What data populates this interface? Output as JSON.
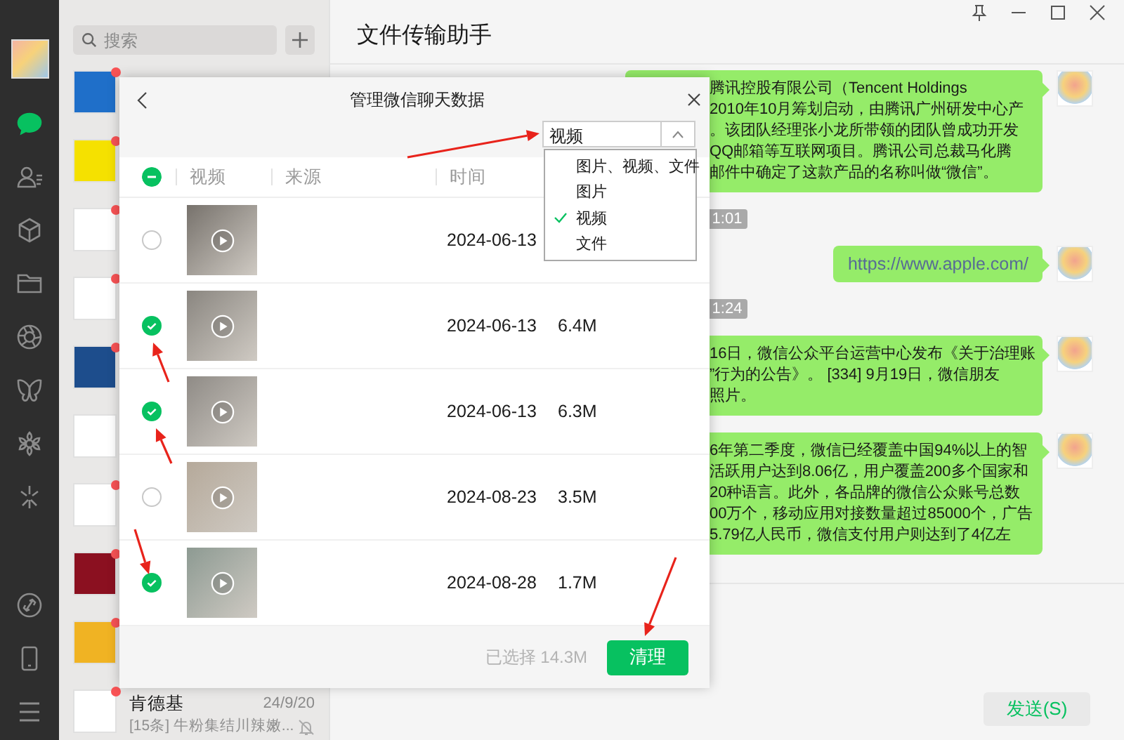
{
  "nav": {
    "top_items": [
      {
        "kind": "chat",
        "selected": true
      },
      {
        "kind": "contacts",
        "selected": false
      },
      {
        "kind": "cube",
        "selected": false
      },
      {
        "kind": "folder",
        "selected": false
      },
      {
        "kind": "aperture",
        "selected": false
      },
      {
        "kind": "butterfly",
        "selected": false
      },
      {
        "kind": "flower",
        "selected": false
      },
      {
        "kind": "sparkle",
        "selected": false
      }
    ],
    "bottom_items": [
      {
        "kind": "link"
      },
      {
        "kind": "phone"
      },
      {
        "kind": "menu"
      }
    ]
  },
  "search": {
    "placeholder": "搜索"
  },
  "chats": [
    {
      "unread": true
    },
    {
      "unread": true
    },
    {
      "unread": true
    },
    {
      "unread": true
    },
    {
      "unread": true
    },
    {
      "unread": false
    },
    {
      "unread": true
    },
    {
      "unread": true
    },
    {
      "unread": true
    },
    {
      "unread": true,
      "name": "肯德基",
      "time": "24/9/20",
      "preview": "[15条] 牛粉集结川辣嫩...",
      "muted": true
    }
  ],
  "chat": {
    "title": "文件传输助手",
    "messages": [
      {
        "kind": "text",
        "lines": [
          "腾讯控股有限公司（Tencent Holdings",
          "2010年10月筹划启动，由腾讯广州研发中心产",
          "。该团队经理张小龙所带领的团队曾成功开发",
          "QQ邮箱等互联网项目。腾讯公司总裁马化腾",
          "邮件中确定了这款产品的名称叫做“微信”。"
        ]
      },
      {
        "kind": "time",
        "text": "1:01"
      },
      {
        "kind": "link",
        "text": "https://www.apple.com/"
      },
      {
        "kind": "time",
        "text": "1:24"
      },
      {
        "kind": "text",
        "lines": [
          "16日，微信公众平台运营中心发布《关于治理账",
          "”行为的公告》。 [334] 9月19日，微信朋友",
          "照片。"
        ]
      },
      {
        "kind": "text",
        "lines": [
          "6年第二季度，微信已经覆盖中国94%以上的智",
          "活跃用户达到8.06亿，用户覆盖200多个国家和",
          "20种语言。此外，各品牌的微信公众账号总数",
          "00万个，移动应用对接数量超过85000个，广告",
          "5.79亿人民币，微信支付用户则达到了4亿左"
        ]
      }
    ],
    "send_button": "发送(S)"
  },
  "dialog": {
    "title": "管理微信聊天数据",
    "filter": {
      "value": "视频",
      "expanded": true,
      "options": [
        {
          "label": "图片、视频、文件",
          "selected": false
        },
        {
          "label": "图片",
          "selected": false
        },
        {
          "label": "视频",
          "selected": true
        },
        {
          "label": "文件",
          "selected": false
        }
      ]
    },
    "select_all_partial": true,
    "columns": [
      "视频",
      "来源",
      "时间"
    ],
    "rows": [
      {
        "checked": false,
        "date": "2024-06-13"
      },
      {
        "checked": true,
        "date": "2024-06-13",
        "size": "6.4M"
      },
      {
        "checked": true,
        "date": "2024-06-13",
        "size": "6.3M"
      },
      {
        "checked": false,
        "date": "2024-08-23",
        "size": "3.5M"
      },
      {
        "checked": true,
        "date": "2024-08-28",
        "size": "1.7M"
      }
    ],
    "selected_total": "已选择 14.3M",
    "clean_button": "清理"
  }
}
